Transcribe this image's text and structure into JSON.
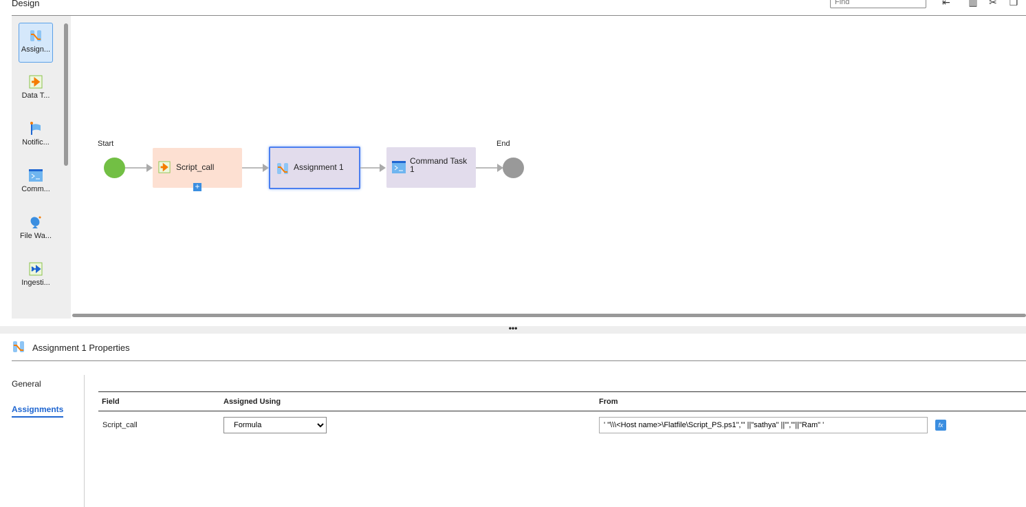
{
  "header": {
    "title": "Design",
    "find_placeholder": "Find"
  },
  "toolbar": {
    "icons": [
      "align-icon",
      "delete-icon",
      "cut-icon",
      "copy-icon"
    ]
  },
  "palette": {
    "items": [
      {
        "label": "Assign...",
        "icon": "assignment-icon",
        "selected": true
      },
      {
        "label": "Data T...",
        "icon": "data-task-icon"
      },
      {
        "label": "Notific...",
        "icon": "notification-icon"
      },
      {
        "label": "Comm...",
        "icon": "command-icon"
      },
      {
        "label": "File Wa...",
        "icon": "file-watch-icon"
      },
      {
        "label": "Ingesti...",
        "icon": "ingestion-icon"
      }
    ]
  },
  "flow": {
    "start": "Start",
    "end": "End",
    "nodes": [
      {
        "label": "Script_call",
        "color": "#fde0d2"
      },
      {
        "label": "Assignment 1",
        "color": "#e2dcec"
      },
      {
        "label": "Command Task 1",
        "color": "#e2dcec"
      }
    ]
  },
  "properties": {
    "title": "Assignment 1 Properties",
    "tabs": [
      "General",
      "Assignments"
    ],
    "active_tab": "Assignments",
    "columns": [
      "Field",
      "Assigned Using",
      "From"
    ],
    "rows": [
      {
        "field": "Script_call",
        "assigned_using": "Formula",
        "from": "' \"\\\\\\<Host name>\\Flatfile\\Script_PS.ps1\",\"' ||\"sathya\" ||\"',\"'||\"Ram\" '"
      }
    ],
    "formula_button": "fx"
  },
  "colors": {
    "accent": "#1f66d1",
    "start": "#72bf44",
    "end": "#999999"
  }
}
